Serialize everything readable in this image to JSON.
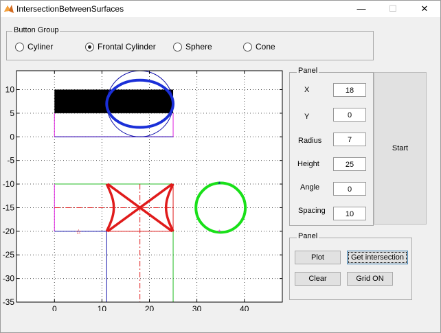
{
  "window": {
    "title": "IntersectionBetweenSurfaces",
    "minimize": "—",
    "maximize": "☐",
    "close": "✕"
  },
  "button_group": {
    "title": "Button Group",
    "options": [
      {
        "label": "Cyliner",
        "selected": false
      },
      {
        "label": "Frontal Cylinder",
        "selected": true
      },
      {
        "label": "Sphere",
        "selected": false
      },
      {
        "label": "Cone",
        "selected": false
      }
    ]
  },
  "params_panel": {
    "title": "Panel",
    "fields": [
      {
        "label": "X",
        "value": "18"
      },
      {
        "label": "Y",
        "value": "0"
      },
      {
        "label": "Radius",
        "value": "7"
      },
      {
        "label": "Height",
        "value": "25"
      },
      {
        "label": "Angle",
        "value": "0"
      },
      {
        "label": "Spacing",
        "value": "10"
      }
    ],
    "start_label": "Start"
  },
  "actions_panel": {
    "title": "Panel",
    "plot_label": "Plot",
    "intersection_label": "Get intersection",
    "clear_label": "Clear",
    "grid_label": "Grid ON"
  },
  "chart_data": {
    "type": "line",
    "xlim": [
      -8,
      48
    ],
    "ylim": [
      -35,
      14
    ],
    "x_ticks": [
      "0",
      "10",
      "20",
      "30",
      "40"
    ],
    "y_ticks": [
      "10",
      "5",
      "0",
      "-5",
      "-10",
      "-15",
      "-20",
      "-25",
      "-30",
      "-35"
    ],
    "grid": true,
    "colors": {
      "black": "#000000",
      "blue": "#1a2fd8",
      "red": "#e01b1b",
      "green": "#19e019",
      "magenta": "#e020e0",
      "thin_green": "#22bb22",
      "navy": "#1010aa"
    }
  }
}
